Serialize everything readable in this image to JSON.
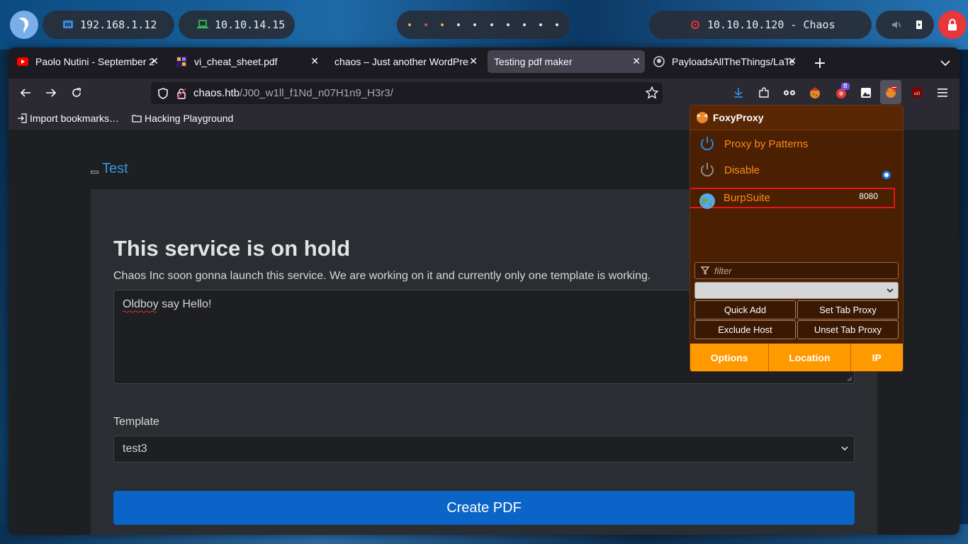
{
  "desktop": {
    "ip_local": "192.168.1.12",
    "ip_vpn": "10.10.14.15",
    "target": "10.10.10.120 - Chaos"
  },
  "browser": {
    "tabs": [
      {
        "label": "Paolo Nutini - September 2",
        "icon": "youtube-icon"
      },
      {
        "label": "vi_cheat_sheet.pdf",
        "icon": "pdf-icon"
      },
      {
        "label": "chaos – Just another WordPres",
        "icon": "none"
      },
      {
        "label": "Testing pdf maker",
        "icon": "none"
      },
      {
        "label": "PayloadsAllTheThings/LaTe",
        "icon": "github-icon"
      }
    ],
    "url_host": "chaos.htb",
    "url_path": "/J00_w1ll_f1Nd_n07H1n9_H3r3/",
    "bookmarks": [
      {
        "label": "Import bookmarks…"
      },
      {
        "label": "Hacking Playground"
      }
    ],
    "ext_badge": "8"
  },
  "page": {
    "link_title": "Test",
    "heading": "This service is on hold",
    "lead": "Chaos Inc soon gonna launch this service. We are working on it and currently only one template is working.",
    "textarea_value": "Oldboy say Hello!",
    "template_label": "Template",
    "template_selected": "test3",
    "create_button": "Create PDF"
  },
  "foxyproxy": {
    "title": "FoxyProxy",
    "items": [
      {
        "label": "Proxy by Patterns"
      },
      {
        "label": "Disable"
      },
      {
        "label": "BurpSuite",
        "port": "8080"
      }
    ],
    "filter_placeholder": "filter",
    "buttons": {
      "quick_add": "Quick Add",
      "set_tab_proxy": "Set Tab Proxy",
      "exclude_host": "Exclude Host",
      "unset_tab_proxy": "Unset Tab Proxy"
    },
    "footer": {
      "options": "Options",
      "location": "Location",
      "ip": "IP"
    },
    "colors": {
      "accent": "#ff9900",
      "bg": "#4a1f02",
      "item_text": "#ff8a1e",
      "highlight": "#e8161c"
    }
  }
}
